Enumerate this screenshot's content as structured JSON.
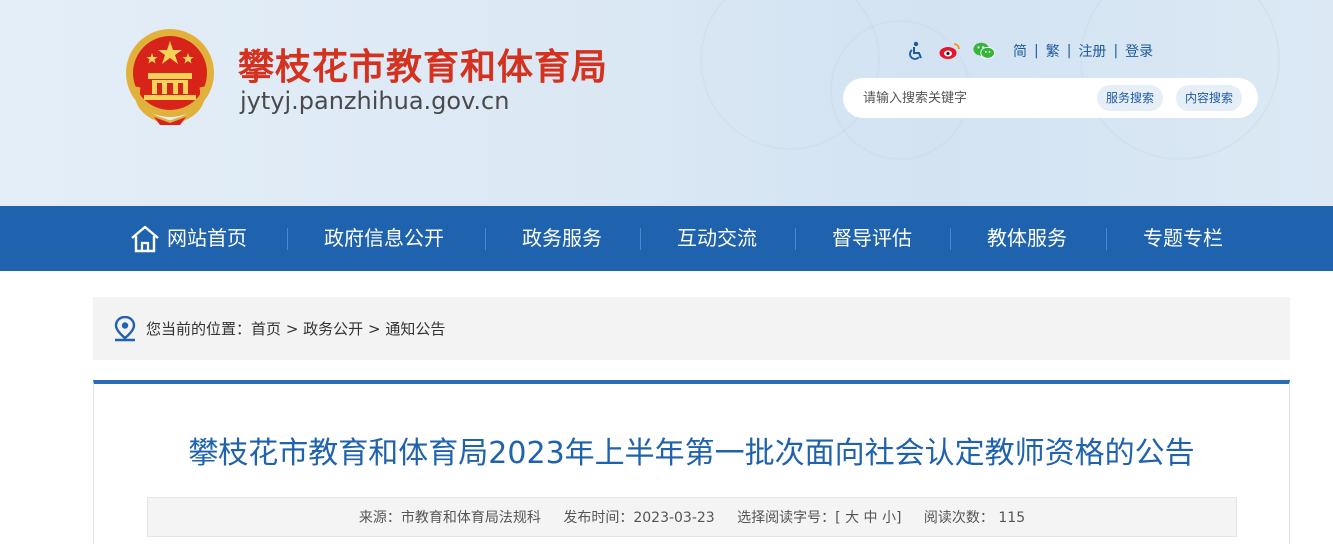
{
  "header": {
    "site_title": "攀枝花市教育和体育局",
    "site_domain": "jytyj.panzhihua.gov.cn",
    "tools": {
      "simplified": "简",
      "traditional": "繁",
      "register": "注册",
      "login": "登录",
      "separator": "|"
    },
    "search": {
      "placeholder": "请输入搜索关键字",
      "service_search": "服务搜索",
      "content_search": "内容搜索"
    }
  },
  "nav": {
    "items": [
      {
        "label": "网站首页"
      },
      {
        "label": "政府信息公开"
      },
      {
        "label": "政务服务"
      },
      {
        "label": "互动交流"
      },
      {
        "label": "督导评估"
      },
      {
        "label": "教体服务"
      },
      {
        "label": "专题专栏"
      }
    ]
  },
  "breadcrumb": {
    "prefix": "您当前的位置：",
    "items": [
      "首页",
      "政务公开",
      "通知公告"
    ],
    "separator": ">"
  },
  "article": {
    "title": "攀枝花市教育和体育局2023年上半年第一批次面向社会认定教师资格的公告",
    "meta": {
      "source_label": "来源：",
      "source_value": "市教育和体育局法规科",
      "date_label": "发布时间：",
      "date_value": "2023-03-23",
      "font_label": "选择阅读字号：",
      "font_open": "[",
      "font_large": "大",
      "font_medium": "中",
      "font_small": "小",
      "font_close": "]",
      "views_label": "阅读次数：",
      "views_value": "115"
    }
  },
  "colors": {
    "brand_red": "#d5311f",
    "nav_blue": "#1f62ad",
    "title_blue": "#1f62ad"
  },
  "icons": {
    "accessibility": "accessibility-icon",
    "weibo": "weibo-icon",
    "wechat": "wechat-icon",
    "home": "home-icon",
    "location": "location-pin-icon",
    "emblem": "national-emblem"
  }
}
